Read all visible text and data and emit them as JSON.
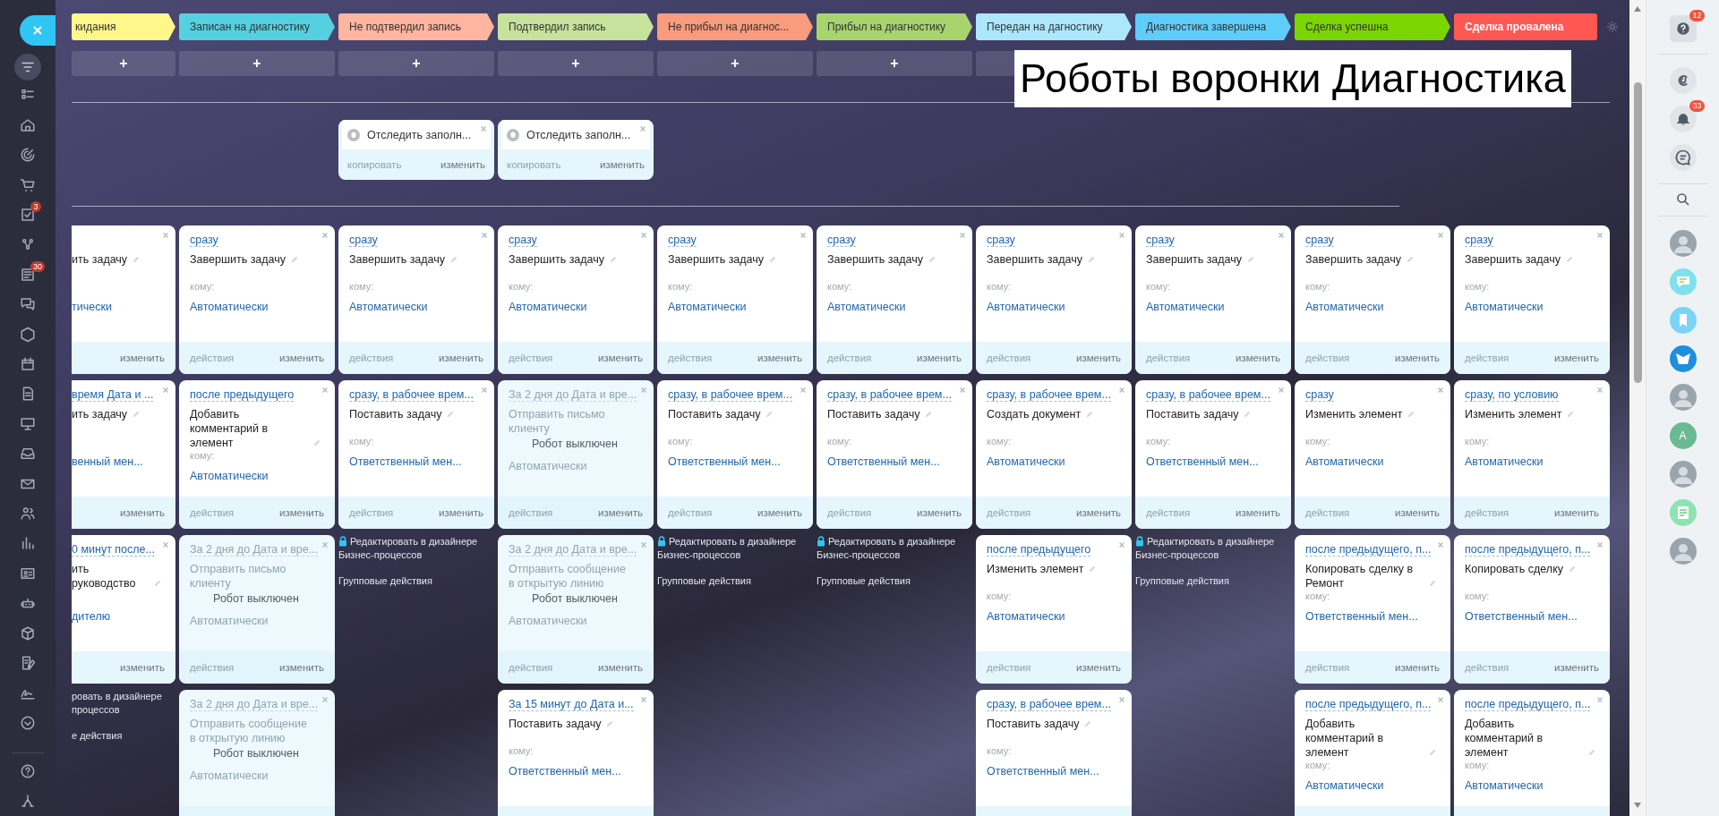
{
  "left_nav": [
    {
      "kind": "filter",
      "selected": true
    },
    {
      "kind": "list",
      "selected": false
    },
    {
      "kind": "house",
      "selected": false
    },
    {
      "kind": "target",
      "selected": false
    },
    {
      "kind": "cart",
      "selected": false
    },
    {
      "kind": "tasks",
      "selected": false,
      "badge": "3"
    },
    {
      "kind": "nodes",
      "selected": false
    },
    {
      "kind": "newspaper",
      "selected": false,
      "badge": "30"
    },
    {
      "kind": "chat",
      "selected": false
    },
    {
      "kind": "hexagon",
      "selected": false
    },
    {
      "kind": "calendar",
      "selected": false
    },
    {
      "kind": "document",
      "selected": false
    },
    {
      "kind": "presentation",
      "selected": false
    },
    {
      "kind": "tray",
      "selected": false
    },
    {
      "kind": "mail",
      "selected": false
    },
    {
      "kind": "people",
      "selected": false
    },
    {
      "kind": "chart",
      "selected": false
    },
    {
      "kind": "contact-card",
      "selected": false
    },
    {
      "kind": "robot",
      "selected": false
    },
    {
      "kind": "box",
      "selected": false
    },
    {
      "kind": "edit-list",
      "selected": false
    },
    {
      "kind": "signature",
      "selected": false
    },
    {
      "kind": "chevron-down",
      "selected": false
    },
    {
      "kind": "help",
      "selected": false
    },
    {
      "kind": "network",
      "selected": false
    }
  ],
  "title_overlay": "Роботы воронки Диагностика",
  "columns": [
    {
      "stage": "кидания",
      "color": "#fff78a",
      "add": "+",
      "robots": [
        {
          "title": "ить задачу",
          "to": "тически",
          "edit": "изменить",
          "enabled": true
        },
        {
          "delay": "время Дата и ...",
          "title": "ить задачу",
          "to": "венный мен...",
          "edit": "изменить",
          "enabled": true
        },
        {
          "delay": "0 минут после...",
          "title": "ить руководство",
          "to": "дителю",
          "edit": "изменить",
          "enabled": true
        }
      ],
      "designer_link": "ровать в дизайнере процессов",
      "group_actions": "е действия"
    },
    {
      "stage": "Записан на диагностику",
      "color": "#55d0e0",
      "add": "+",
      "robots": [
        {
          "delay": "сразу",
          "title": "Завершить задачу",
          "to_label": "кому:",
          "to": "Автоматически",
          "actions": "действия",
          "edit": "изменить",
          "enabled": true
        },
        {
          "delay": "после предыдущего",
          "title": "Добавить комментарий в элемент",
          "to_label": "кому:",
          "to": "Автоматически",
          "actions": "действия",
          "edit": "изменить",
          "enabled": true
        },
        {
          "delay": "За 2 дня до Дата и вре...",
          "title": "Отправить письмо клиенту",
          "note": "Робот выключен",
          "to": "Автоматически",
          "actions": "действия",
          "edit": "изменить",
          "enabled": false
        },
        {
          "delay": "За 2 дня до Дата и вре...",
          "title": "Отправить сообщение в открытую линию",
          "note": "Робот выключен",
          "to": "Автоматически",
          "enabled": false
        }
      ]
    },
    {
      "stage": "Не подтвердил запись",
      "color": "#ffb59f",
      "add": "+",
      "triggers": [
        {
          "title": "Отследить заполн...",
          "copy": "копировать",
          "edit": "изменить"
        }
      ],
      "robots": [
        {
          "delay": "сразу",
          "title": "Завершить задачу",
          "to_label": "кому:",
          "to": "Автоматически",
          "actions": "действия",
          "edit": "изменить",
          "enabled": true
        },
        {
          "delay": "сразу, в рабочее врем...",
          "title": "Поставить задачу",
          "to_label": "кому:",
          "to": "Ответственный мен...",
          "actions": "действия",
          "edit": "изменить",
          "enabled": true
        }
      ],
      "designer_link": "Редактировать в дизайнере Бизнес-процессов",
      "group_actions": "Групповые действия"
    },
    {
      "stage": "Подтвердил запись",
      "color": "#c6e29c",
      "add": "+",
      "triggers": [
        {
          "title": "Отследить заполн...",
          "copy": "копировать",
          "edit": "изменить"
        }
      ],
      "robots": [
        {
          "delay": "сразу",
          "title": "Завершить задачу",
          "to_label": "кому:",
          "to": "Автоматически",
          "actions": "действия",
          "edit": "изменить",
          "enabled": true
        },
        {
          "delay": "За 2 дня до Дата и вре...",
          "title": "Отправить письмо клиенту",
          "note": "Робот выключен",
          "to": "Автоматически",
          "actions": "действия",
          "edit": "изменить",
          "enabled": false
        },
        {
          "delay": "За 2 дня до Дата и вре...",
          "title": "Отправить сообщение в открытую линию",
          "note": "Робот выключен",
          "to": "Автоматически",
          "actions": "действия",
          "edit": "изменить",
          "enabled": false
        },
        {
          "delay": "За 15 минут до Дата и...",
          "title": "Поставить задачу",
          "to_label": "кому:",
          "to": "Ответственный мен...",
          "enabled": true
        }
      ]
    },
    {
      "stage": "Не прибыл на диагнос...",
      "color": "#f99b7d",
      "add": "+",
      "robots": [
        {
          "delay": "сразу",
          "title": "Завершить задачу",
          "to_label": "кому:",
          "to": "Автоматически",
          "actions": "действия",
          "edit": "изменить",
          "enabled": true
        },
        {
          "delay": "сразу, в рабочее врем...",
          "title": "Поставить задачу",
          "to_label": "кому:",
          "to": "Ответственный мен...",
          "actions": "действия",
          "edit": "изменить",
          "enabled": true
        }
      ],
      "designer_link": "Редактировать в дизайнере Бизнес-процессов",
      "group_actions": "Групповые действия"
    },
    {
      "stage": "Прибыл на диагностику",
      "color": "#a8d46e",
      "add": "+",
      "robots": [
        {
          "delay": "сразу",
          "title": "Завершить задачу",
          "to_label": "кому:",
          "to": "Автоматически",
          "actions": "действия",
          "edit": "изменить",
          "enabled": true
        },
        {
          "delay": "сразу, в рабочее врем...",
          "title": "Поставить задачу",
          "to_label": "кому:",
          "to": "Ответственный мен...",
          "actions": "действия",
          "edit": "изменить",
          "enabled": true
        }
      ],
      "designer_link": "Редактировать в дизайнере Бизнес-процессов",
      "group_actions": "Групповые действия"
    },
    {
      "stage": "Передан на дагностику",
      "color": "#ade7fb",
      "robots": [
        {
          "delay": "сразу",
          "title": "Завершить задачу",
          "to_label": "кому:",
          "to": "Автоматически",
          "actions": "действия",
          "edit": "изменить",
          "enabled": true
        },
        {
          "delay": "сразу, в рабочее врем...",
          "title": "Создать документ",
          "to_label": "кому:",
          "to": "Автоматически",
          "actions": "действия",
          "edit": "изменить",
          "enabled": true
        },
        {
          "delay": "после предыдущего",
          "title": "Изменить элемент",
          "to_label": "кому:",
          "to": "Автоматически",
          "actions": "действия",
          "edit": "изменить",
          "enabled": true
        },
        {
          "delay": "сразу, в рабочее врем...",
          "title": "Поставить задачу",
          "to_label": "кому:",
          "to": "Ответственный мен...",
          "enabled": true
        }
      ]
    },
    {
      "stage": "Диагностика завершена",
      "color": "#5fcdf9",
      "robots": [
        {
          "delay": "сразу",
          "title": "Завершить задачу",
          "to_label": "кому:",
          "to": "Автоматически",
          "actions": "действия",
          "edit": "изменить",
          "enabled": true
        },
        {
          "delay": "сразу, в рабочее врем...",
          "title": "Поставить задачу",
          "to_label": "кому:",
          "to": "Ответственный мен...",
          "actions": "действия",
          "edit": "изменить",
          "enabled": true
        }
      ],
      "designer_link": "Редактировать в дизайнере Бизнес-процессов",
      "group_actions": "Групповые действия"
    },
    {
      "stage": "Сделка успешна",
      "color": "#7bd500",
      "robots": [
        {
          "delay": "сразу",
          "title": "Завершить задачу",
          "to_label": "кому:",
          "to": "Автоматически",
          "actions": "действия",
          "edit": "изменить",
          "enabled": true
        },
        {
          "delay": "сразу",
          "title": "Изменить элемент",
          "to_label": "кому:",
          "to": "Автоматически",
          "actions": "действия",
          "edit": "изменить",
          "enabled": true
        },
        {
          "delay": "после предыдущего, п...",
          "title": "Копировать сделку в Ремонт",
          "to_label": "кому:",
          "to": "Ответственный мен...",
          "actions": "действия",
          "edit": "изменить",
          "enabled": true
        },
        {
          "delay": "после предыдущего, п...",
          "title": "Добавить комментарий в элемент",
          "to_label": "кому:",
          "to": "Автоматически",
          "enabled": true
        }
      ]
    },
    {
      "stage": "Сделка провалена",
      "color": "#ff5752",
      "robots": [
        {
          "delay": "сразу",
          "title": "Завершить задачу",
          "to_label": "кому:",
          "to": "Автоматически",
          "actions": "действия",
          "edit": "изменить",
          "enabled": true
        },
        {
          "delay": "сразу, по условию",
          "title": "Изменить элемент",
          "to_label": "кому:",
          "to": "Автоматически",
          "actions": "действия",
          "edit": "изменить",
          "enabled": true
        },
        {
          "delay": "после предыдущего, п...",
          "title": "Копировать сделку",
          "to_label": "кому:",
          "to": "Ответственный мен...",
          "actions": "действия",
          "edit": "изменить",
          "enabled": true
        },
        {
          "delay": "после предыдущего, п...",
          "title": "Добавить комментарий в элемент",
          "to_label": "кому:",
          "to": "Автоматически",
          "enabled": true
        }
      ]
    }
  ],
  "right_panel": {
    "help_badge": "12",
    "notifications_badge": "33",
    "contacts": [
      {
        "kind": "photo"
      },
      {
        "kind": "chat"
      },
      {
        "kind": "bookmark"
      },
      {
        "kind": "bot"
      },
      {
        "kind": "photo"
      },
      {
        "kind": "letter",
        "letter": "A"
      },
      {
        "kind": "photo"
      },
      {
        "kind": "doc"
      },
      {
        "kind": "photo"
      }
    ]
  }
}
